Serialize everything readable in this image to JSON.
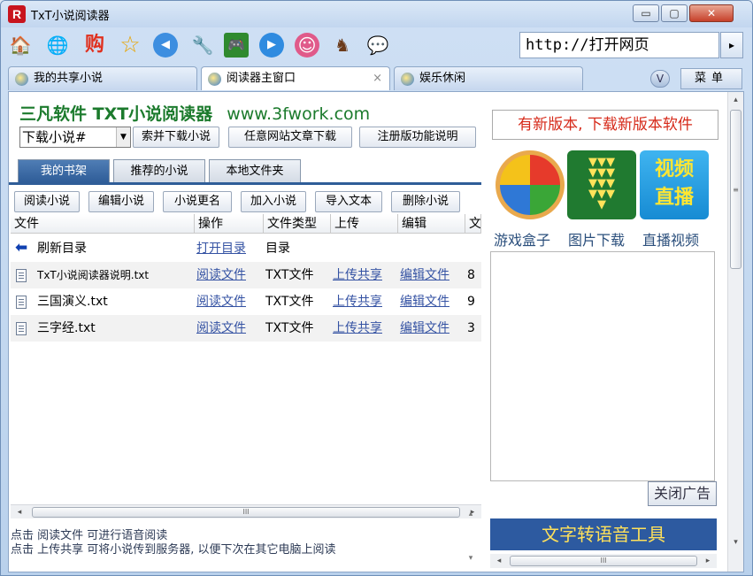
{
  "window": {
    "title": "TxT小说阅读器",
    "logo_letter": "R",
    "min_symbol": "▭",
    "max_symbol": "▢",
    "close_symbol": "✕"
  },
  "toolbar": {
    "icons": [
      {
        "name": "home-icon",
        "glyph": "🏠"
      },
      {
        "name": "globe-icon",
        "glyph": "🌐"
      },
      {
        "name": "shop-icon",
        "glyph": "购"
      },
      {
        "name": "star-icon",
        "glyph": "☆"
      },
      {
        "name": "back-circle-icon",
        "glyph": "◀"
      },
      {
        "name": "tools-icon",
        "glyph": "🔧"
      },
      {
        "name": "game-icon",
        "glyph": "🎮"
      },
      {
        "name": "play-icon",
        "glyph": "▶"
      },
      {
        "name": "avatar-girl-icon",
        "glyph": "☺"
      },
      {
        "name": "character-icon",
        "glyph": "♞"
      },
      {
        "name": "chat-bubble-icon",
        "glyph": "💬"
      }
    ],
    "address": "http://打开网页",
    "go_symbol": "▸"
  },
  "tabs": [
    {
      "label": "我的共享小说",
      "active": false
    },
    {
      "label": "阅读器主窗口",
      "active": true,
      "close": "×"
    },
    {
      "label": "娱乐休闲",
      "active": false
    }
  ],
  "v_button": "V",
  "menu_button": "菜单",
  "brand": {
    "name": "三凡软件 TXT小说阅读器",
    "url": "www.3fwork.com"
  },
  "download": {
    "select_value": "下载小说#",
    "arrow": "▼",
    "search_btn": "索并下载小说",
    "any_site_btn": "任意网站文章下载",
    "register_btn": "注册版功能说明"
  },
  "shelf_tabs": [
    "我的书架",
    "推荐的小说",
    "本地文件夹"
  ],
  "actions": [
    "阅读小说",
    "编辑小说",
    "小说更名",
    "加入小说",
    "导入文本",
    "删除小说"
  ],
  "table": {
    "columns": [
      "文件",
      "操作",
      "文件类型",
      "上传",
      "编辑",
      "文"
    ],
    "rows": [
      {
        "name": "刷新目录",
        "op": "打开目录",
        "type": "目录",
        "upload": "",
        "edit": "",
        "extra": "",
        "icon": "back"
      },
      {
        "name": "TxT小说阅读器说明.txt",
        "op": "阅读文件",
        "type": "TXT文件",
        "upload": "上传共享",
        "edit": "编辑文件",
        "extra": "8",
        "icon": "file"
      },
      {
        "name": "三国演义.txt",
        "op": "阅读文件",
        "type": "TXT文件",
        "upload": "上传共享",
        "edit": "编辑文件",
        "extra": "9",
        "icon": "file"
      },
      {
        "name": "三字经.txt",
        "op": "阅读文件",
        "type": "TXT文件",
        "upload": "上传共享",
        "edit": "编辑文件",
        "extra": "3",
        "icon": "file"
      }
    ]
  },
  "scroll": {
    "grip": "III",
    "left": "◂",
    "right": "▸",
    "up": "▴",
    "down": "▾"
  },
  "status": {
    "line1": "点击 阅读文件 可进行语音阅读",
    "line2": "点击 上传共享 可将小说传到服务器, 以便下次在其它电脑上阅读"
  },
  "right": {
    "update": "有新版本, 下载新版本软件",
    "tiles": [
      {
        "label": "游戏盒子"
      },
      {
        "label": "图片下载",
        "art": "≚≚≚≚≚"
      },
      {
        "label": "直播视频",
        "art_line1": "视频",
        "art_line2": "直播"
      }
    ],
    "close_ad": "关闭广告",
    "tts": "文字转语音工具"
  },
  "colors": {
    "brand_green": "#1b7a2c",
    "accent_blue": "#2f5d98",
    "alert_red": "#d62a1a"
  }
}
